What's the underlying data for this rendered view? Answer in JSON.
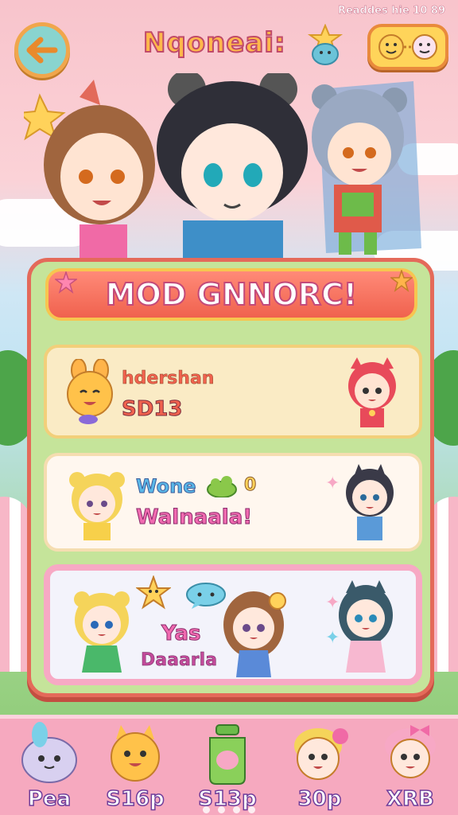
{
  "header": {
    "title": "Nqoneai:",
    "corner_text": "Readdes hie 10 89"
  },
  "panel": {
    "banner_title": "MOD GNNORC!",
    "cards": [
      {
        "line1": "hdershan",
        "line2": "SD13"
      },
      {
        "line1": "Wone",
        "line1_badge": "0",
        "line2": "Walnaala!"
      },
      {
        "line1": "Yas",
        "line2": "Daaarla"
      }
    ]
  },
  "bottom_nav": {
    "items": [
      {
        "label": "Pea",
        "icon": "seal-pet-icon"
      },
      {
        "label": "S16p",
        "icon": "cat-pet-icon"
      },
      {
        "label": "S13p",
        "icon": "potion-jar-icon"
      },
      {
        "label": "30p",
        "icon": "chibi-flower-icon"
      },
      {
        "label": "XRB",
        "icon": "chibi-bow-icon"
      }
    ]
  },
  "colors": {
    "accent": "#f0624e",
    "panel_border": "#e46a5a",
    "card_highlight_border": "#f7a9c4",
    "bottom_bar": "#f6a9bf"
  }
}
